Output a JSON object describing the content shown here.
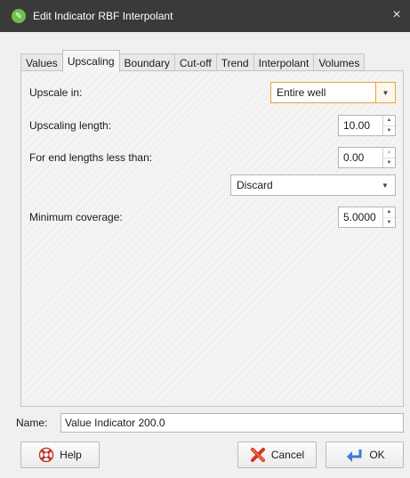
{
  "window": {
    "title": "Edit Indicator RBF Interpolant",
    "close_glyph": "×"
  },
  "tabs": [
    {
      "label": "Values",
      "active": false
    },
    {
      "label": "Upscaling",
      "active": true
    },
    {
      "label": "Boundary",
      "active": false
    },
    {
      "label": "Cut-off",
      "active": false
    },
    {
      "label": "Trend",
      "active": false
    },
    {
      "label": "Interpolant",
      "active": false
    },
    {
      "label": "Volumes",
      "active": false
    }
  ],
  "upscaling": {
    "upscale_in_label": "Upscale in:",
    "upscale_in_value": "Entire well",
    "upscaling_length_label": "Upscaling length:",
    "upscaling_length_value": "10.00",
    "end_lengths_label": "For end lengths less than:",
    "end_lengths_value": "0.00",
    "end_action_value": "Discard",
    "minimum_coverage_label": "Minimum coverage:",
    "minimum_coverage_value": "5.0000"
  },
  "name": {
    "label": "Name:",
    "value": "Value Indicator 200.0"
  },
  "buttons": {
    "help": "Help",
    "cancel": "Cancel",
    "ok": "OK"
  },
  "icons": {
    "app": "leapfrog-app-icon",
    "help": "lifebuoy-icon",
    "cancel": "red-x-icon",
    "ok": "enter-arrow-icon",
    "combo": "chevron-down-icon",
    "spin": "spin-arrows-icon"
  },
  "colors": {
    "titlebar": "#3a3a3a",
    "focus_accent": "#e3a341",
    "app_icon": "#6cc04a"
  }
}
